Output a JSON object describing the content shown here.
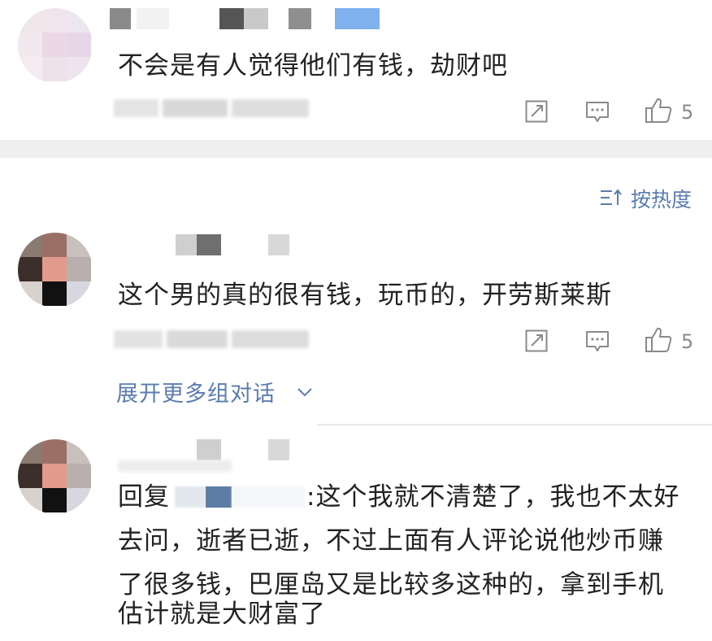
{
  "comments": [
    {
      "text": "不会是有人觉得他们有钱，劫财吧",
      "share_icon": "share-icon",
      "reply_icon": "comment-icon",
      "like_icon": "thumbs-up-icon",
      "like_count": "5"
    },
    {
      "text": "这个男的真的很有钱，玩币的，开劳斯莱斯",
      "share_icon": "share-icon",
      "reply_icon": "comment-icon",
      "like_icon": "thumbs-up-icon",
      "like_count": "5"
    }
  ],
  "sort_label": "按热度",
  "sort_icon": "sort-icon",
  "expand_label": "展开更多组对话",
  "expand_icon": "chevron-down-icon",
  "reply": {
    "prefix": "回复",
    "line1": ":这个我就不清楚了，我也不太好",
    "line2": "去问，逝者已逝，不过上面有人评论说他炒币赚",
    "line3": "了很多钱，巴厘岛又是比较多这种的，拿到手机",
    "line4": "估计就是大财富了"
  },
  "colors": {
    "link": "#5b7cb0",
    "text": "#222222",
    "icon": "#8a8a8a",
    "separator": "#efefef"
  }
}
